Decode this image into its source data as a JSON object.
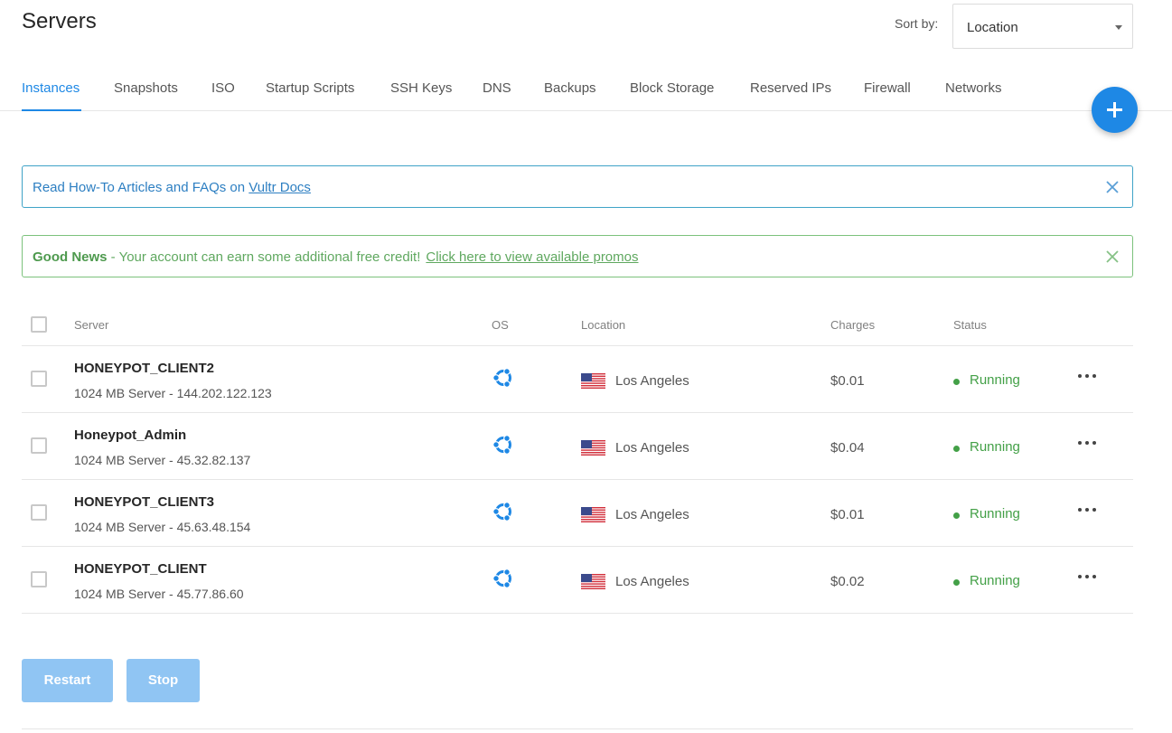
{
  "header": {
    "title": "Servers",
    "sort_label": "Sort by:",
    "sort_value": "Location"
  },
  "tabs": [
    {
      "label": "Instances",
      "active": true
    },
    {
      "label": "Snapshots"
    },
    {
      "label": "ISO"
    },
    {
      "label": "Startup Scripts"
    },
    {
      "label": "SSH Keys"
    },
    {
      "label": "DNS"
    },
    {
      "label": "Backups"
    },
    {
      "label": "Block Storage"
    },
    {
      "label": "Reserved IPs"
    },
    {
      "label": "Firewall"
    },
    {
      "label": "Networks"
    }
  ],
  "banners": {
    "info": {
      "text": "Read How-To Articles and FAQs on ",
      "link": "Vultr Docs"
    },
    "promo": {
      "bold": "Good News",
      "text": " - Your account can earn some additional free credit!",
      "link": "Click here to view available promos"
    }
  },
  "table": {
    "columns": {
      "server": "Server",
      "os": "OS",
      "location": "Location",
      "charges": "Charges",
      "status": "Status"
    },
    "rows": [
      {
        "name": "HONEYPOT_CLIENT2",
        "detail": "1024 MB Server - 144.202.122.123",
        "os_icon": "ubuntu-icon",
        "location": "Los Angeles",
        "charges": "$0.01",
        "status": "Running"
      },
      {
        "name": "Honeypot_Admin",
        "detail": "1024 MB Server - 45.32.82.137",
        "os_icon": "ubuntu-icon",
        "location": "Los Angeles",
        "charges": "$0.04",
        "status": "Running"
      },
      {
        "name": "HONEYPOT_CLIENT3",
        "detail": "1024 MB Server - 45.63.48.154",
        "os_icon": "ubuntu-icon",
        "location": "Los Angeles",
        "charges": "$0.01",
        "status": "Running"
      },
      {
        "name": "HONEYPOT_CLIENT",
        "detail": "1024 MB Server - 45.77.86.60",
        "os_icon": "ubuntu-icon",
        "location": "Los Angeles",
        "charges": "$0.02",
        "status": "Running"
      }
    ]
  },
  "actions": {
    "restart": "Restart",
    "stop": "Stop"
  },
  "colors": {
    "accent": "#1e88e5",
    "running": "#43a047",
    "info_border": "#3fa3c7",
    "promo_border": "#7cc27c",
    "disabled_button": "#90c5f3"
  }
}
